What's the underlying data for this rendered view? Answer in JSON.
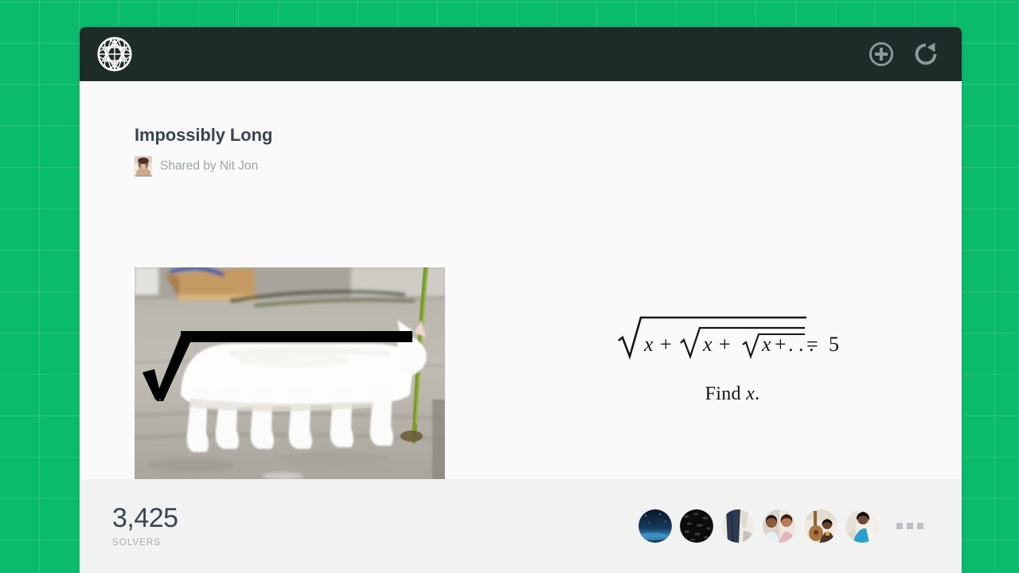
{
  "background": {
    "color": "#0aba6d",
    "grid": "true"
  },
  "header": {
    "background": "#1d2b29",
    "logo_icon": "geodesic-sphere-logo",
    "add_icon": "plus-circle-icon",
    "refresh_icon": "refresh-icon"
  },
  "puzzle": {
    "title": "Impossibly Long",
    "shared_by": "Shared by Nit Jon",
    "sharer_avatar_icon": "sharer-avatar-photo",
    "image_alt": "long-white-cat-with-radical-overlay",
    "equation_alt": "nested-radical-equation",
    "equation_text": "sqrt(x + sqrt(x + sqrt(x + ...))) = 5",
    "equation_result": "5",
    "prompt_prefix": "Find ",
    "prompt_variable": "x",
    "prompt_suffix": "."
  },
  "footer": {
    "background": "#f1f2f2",
    "solvers_count": "3,425",
    "solvers_label": "SOLVERS",
    "more_icon": "more-dots-icon",
    "avatars": [
      {
        "name": "solver-avatar-1",
        "desc": "night-sky-over-water"
      },
      {
        "name": "solver-avatar-2",
        "desc": "dark-textured-surface"
      },
      {
        "name": "solver-avatar-3",
        "desc": "denim-jeans-photo"
      },
      {
        "name": "solver-avatar-4",
        "desc": "two-people-portrait"
      },
      {
        "name": "solver-avatar-5",
        "desc": "person-with-guitar"
      },
      {
        "name": "solver-avatar-6",
        "desc": "person-in-blue-top"
      }
    ]
  }
}
